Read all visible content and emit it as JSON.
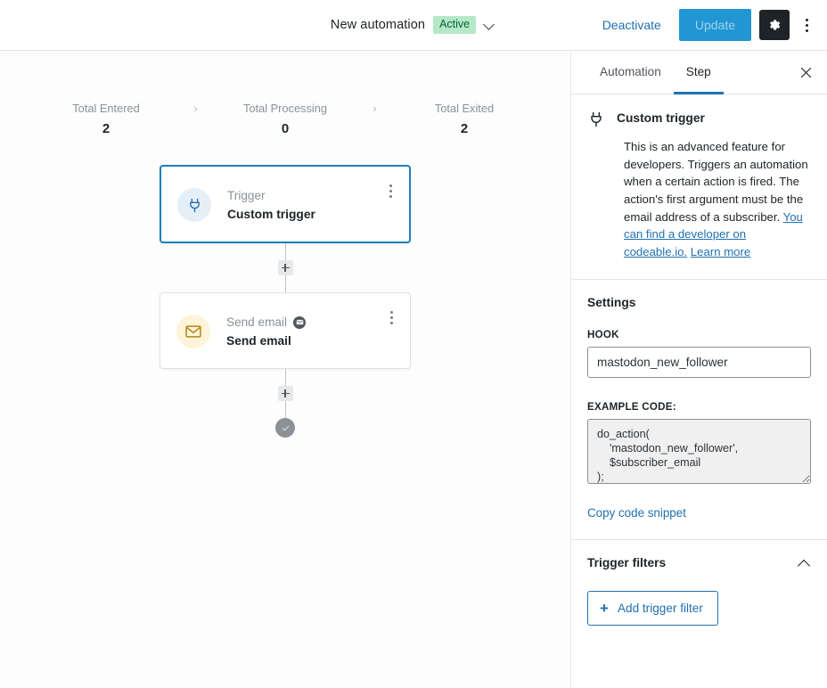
{
  "topbar": {
    "title": "New automation",
    "status_badge": "Active",
    "status_chevron_icon": "chevron-down-icon",
    "deactivate_label": "Deactivate",
    "update_label": "Update",
    "gear_icon": "gear-icon",
    "kebab_icon": "more-vertical-icon",
    "accent_blue": "#2196d3",
    "badge_bg": "#b6e8c8",
    "badge_fg": "#006432"
  },
  "canvas": {
    "stats": [
      {
        "label": "Total Entered",
        "value": "2"
      },
      {
        "label": "Total Processing",
        "value": "0"
      },
      {
        "label": "Total Exited",
        "value": "2"
      }
    ],
    "stat_arrow_icon": "chevron-right-icon",
    "nodes": [
      {
        "type_label": "Trigger",
        "title": "Custom trigger",
        "icon": "plug-icon",
        "icon_bg": "#e5eff8",
        "selected": true,
        "has_badge": false,
        "kebab_icon": "more-vertical-icon"
      },
      {
        "type_label": "Send email",
        "title": "Send email",
        "icon": "envelope-icon",
        "icon_bg": "#fdf4d9",
        "selected": false,
        "has_badge": true,
        "badge_icon": "envelope-badge-icon",
        "kebab_icon": "more-vertical-icon"
      }
    ],
    "add_step_icon": "plus-icon",
    "end_icon": "check-icon"
  },
  "panel": {
    "tabs": [
      {
        "label": "Automation",
        "active": false
      },
      {
        "label": "Step",
        "active": true
      }
    ],
    "close_icon": "close-icon",
    "step": {
      "icon": "plug-icon",
      "title": "Custom trigger",
      "description_text": "This is an advanced feature for developers. Triggers an automation when a certain action is fired. The action's first argument must be the email address of a subscriber. ",
      "link_codeable": "You can find a developer on codeable.io.",
      "link_learn_more": "Learn more"
    },
    "settings": {
      "title": "Settings",
      "hook_label": "HOOK",
      "hook_value": "mastodon_new_follower",
      "hook_placeholder": "",
      "code_label": "EXAMPLE CODE:",
      "code_value": "do_action(\n    'mastodon_new_follower',\n    $subscriber_email\n);",
      "copy_label": "Copy code snippet"
    },
    "trigger_filters": {
      "title": "Trigger filters",
      "collapse_icon": "chevron-up-icon",
      "add_button_label": "Add trigger filter",
      "add_button_icon": "plus-icon"
    }
  }
}
